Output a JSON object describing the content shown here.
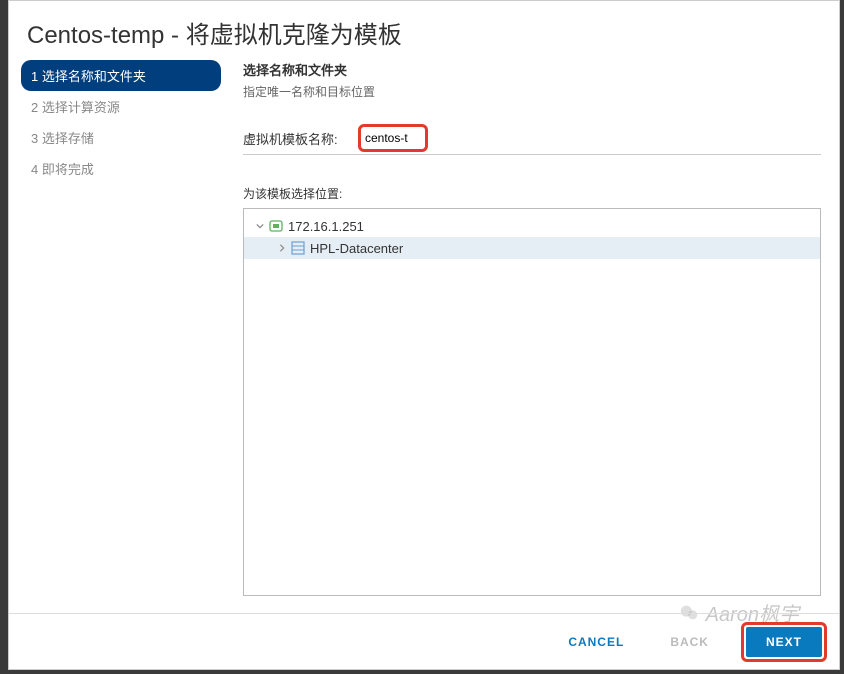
{
  "dialog": {
    "title": "Centos-temp - 将虚拟机克隆为模板"
  },
  "steps": {
    "s1": "1 选择名称和文件夹",
    "s2": "2 选择计算资源",
    "s3": "3 选择存储",
    "s4": "4 即将完成"
  },
  "panel": {
    "heading": "选择名称和文件夹",
    "sub": "指定唯一名称和目标位置",
    "fieldLabel": "虚拟机模板名称:",
    "fieldValue": "centos-t",
    "locationLabel": "为该模板选择位置:"
  },
  "tree": {
    "root": "172.16.1.251",
    "child": "HPL-Datacenter"
  },
  "footer": {
    "cancel": "CANCEL",
    "back": "BACK",
    "next": "NEXT"
  },
  "watermark": "Aaron枫宇"
}
